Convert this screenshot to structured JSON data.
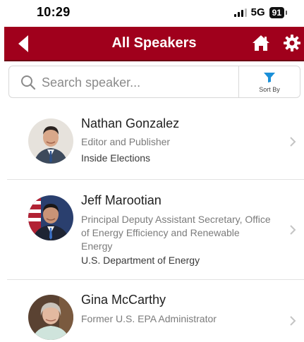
{
  "status_bar": {
    "time": "10:29",
    "network": "5G",
    "battery": "91"
  },
  "nav": {
    "title": "All Speakers",
    "back_icon": "back-arrow-icon",
    "home_icon": "home-icon",
    "settings_icon": "gear-icon",
    "color": "#a0001c"
  },
  "search": {
    "placeholder": "Search speaker...",
    "value": "",
    "sort_label": "Sort By",
    "sort_icon_color": "#1a8fd8"
  },
  "speakers": [
    {
      "name": "Nathan Gonzalez",
      "title": "Editor and Publisher",
      "organization": "Inside Elections"
    },
    {
      "name": "Jeff Marootian",
      "title": "Principal Deputy Assistant Secretary, Office of Energy Efficiency and Renewable Energy",
      "organization": "U.S. Department of Energy"
    },
    {
      "name": "Gina McCarthy",
      "title": "Former U.S. EPA Administrator",
      "organization": ""
    }
  ]
}
